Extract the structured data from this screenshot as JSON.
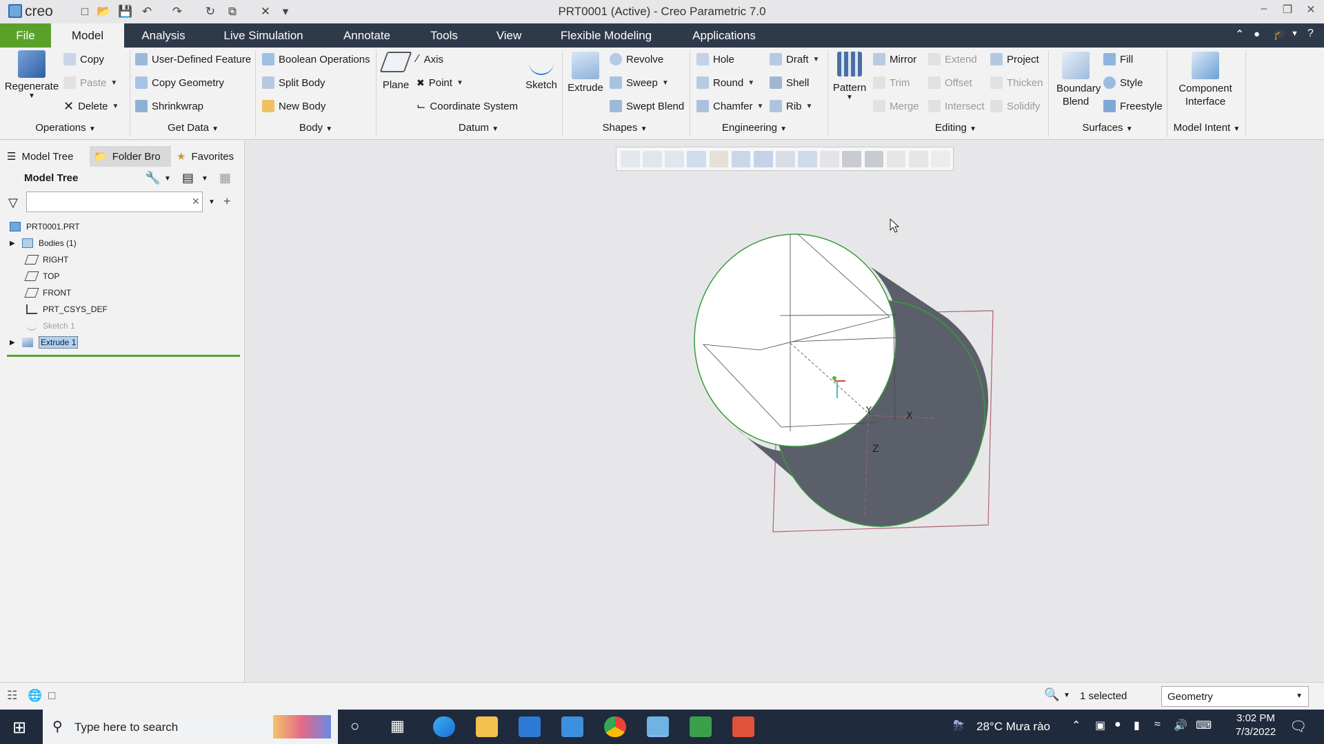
{
  "app": {
    "logo": "creo",
    "title": "PRT0001 (Active) - Creo Parametric 7.0"
  },
  "quick_access": [
    "new-icon",
    "open-icon",
    "save-icon",
    "undo-icon",
    "redo-icon",
    "regenerate-icon",
    "windows-icon",
    "close-icon",
    "customize-icon"
  ],
  "menu": {
    "file": "File",
    "tabs": [
      "Model",
      "Analysis",
      "Live Simulation",
      "Annotate",
      "Tools",
      "View",
      "Flexible Modeling",
      "Applications"
    ]
  },
  "ribbon": {
    "operations": {
      "regenerate": "Regenerate",
      "copy": "Copy",
      "paste": "Paste",
      "delete": "Delete",
      "group": "Operations"
    },
    "get_data": {
      "udf": "User-Defined Feature",
      "copy_geometry": "Copy Geometry",
      "shrinkwrap": "Shrinkwrap",
      "group": "Get Data"
    },
    "body": {
      "boolean": "Boolean Operations",
      "split": "Split Body",
      "new": "New Body",
      "group": "Body"
    },
    "datum": {
      "plane": "Plane",
      "axis": "Axis",
      "point": "Point",
      "csys": "Coordinate System",
      "sketch": "Sketch",
      "group": "Datum"
    },
    "shapes": {
      "extrude": "Extrude",
      "revolve": "Revolve",
      "sweep": "Sweep",
      "swept_blend": "Swept Blend",
      "group": "Shapes"
    },
    "engineering": {
      "hole": "Hole",
      "round": "Round",
      "chamfer": "Chamfer",
      "draft": "Draft",
      "shell": "Shell",
      "rib": "Rib",
      "group": "Engineering"
    },
    "editing": {
      "pattern": "Pattern",
      "mirror": "Mirror",
      "trim": "Trim",
      "merge": "Merge",
      "extend": "Extend",
      "offset": "Offset",
      "intersect": "Intersect",
      "project": "Project",
      "thicken": "Thicken",
      "solidify": "Solidify",
      "group": "Editing"
    },
    "surfaces": {
      "boundary_blend": "Boundary Blend",
      "fill": "Fill",
      "style": "Style",
      "freestyle": "Freestyle",
      "group": "Surfaces"
    },
    "model_intent": {
      "component_interface": "Component Interface",
      "group": "Model Intent"
    }
  },
  "panel": {
    "tabs": [
      "Model Tree",
      "Folder Bro",
      "Favorites"
    ],
    "header": "Model Tree",
    "search_placeholder": "",
    "tree": [
      {
        "label": "PRT0001.PRT",
        "icon": "part-icon"
      },
      {
        "label": "Bodies (1)",
        "icon": "bodies-icon"
      },
      {
        "label": "RIGHT",
        "icon": "datum-plane-icon"
      },
      {
        "label": "TOP",
        "icon": "datum-plane-icon"
      },
      {
        "label": "FRONT",
        "icon": "datum-plane-icon"
      },
      {
        "label": "PRT_CSYS_DEF",
        "icon": "csys-icon"
      },
      {
        "label": "Sketch 1",
        "icon": "sketch-icon"
      },
      {
        "label": "Extrude 1",
        "icon": "extrude-icon"
      }
    ]
  },
  "viewport": {
    "axis_labels": {
      "x": "X",
      "y": "Y",
      "z": "Z"
    }
  },
  "status": {
    "selected": "1 selected",
    "filter": "Geometry"
  },
  "taskbar": {
    "search_placeholder": "Type here to search",
    "weather": "28°C  Mưa rào",
    "time": "3:02 PM",
    "date": "7/3/2022"
  },
  "colors": {
    "menubar": "#2e3a4a",
    "file_tab": "#5aa12a",
    "selection_green": "#5aa12a",
    "solid_face": "#5b5f6a",
    "taskbar": "#1f2a3c"
  }
}
